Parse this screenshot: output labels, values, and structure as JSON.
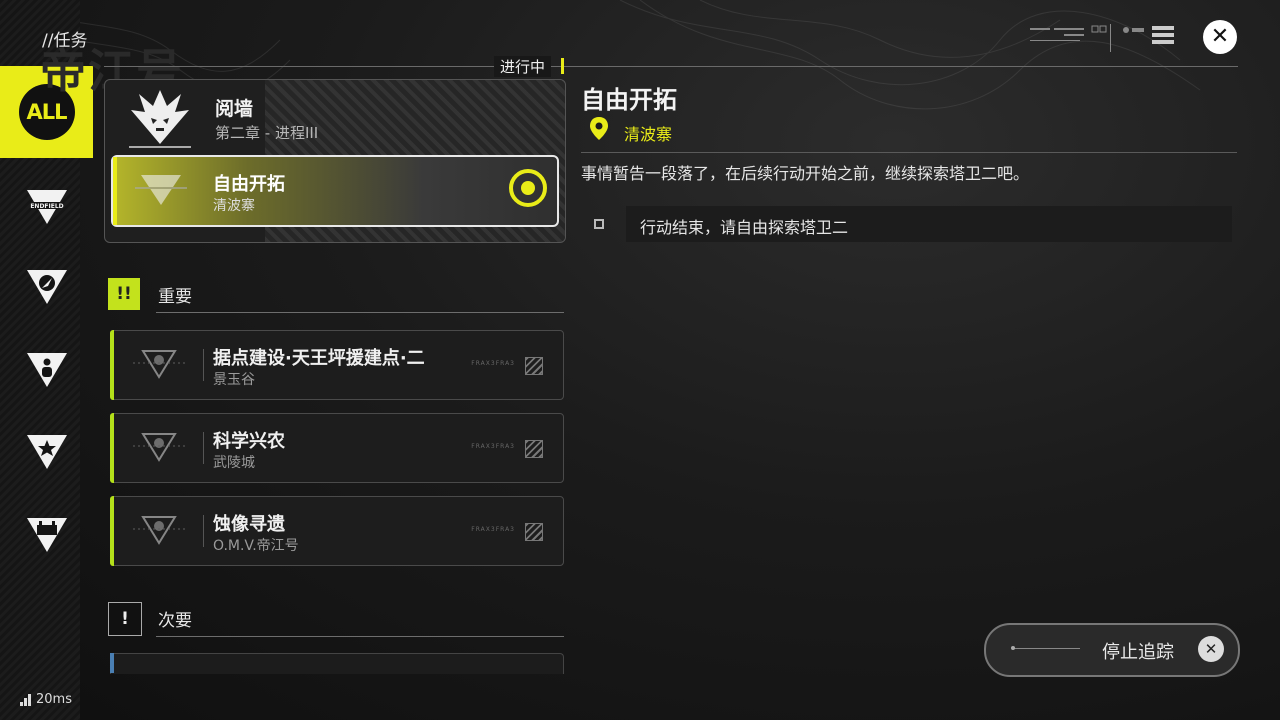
{
  "header": {
    "title": "//任务",
    "bg_title": "帝江号"
  },
  "categories": [
    {
      "key": "all",
      "label": "ALL",
      "active": true
    },
    {
      "key": "endfield",
      "label": "ENDFIELD"
    },
    {
      "key": "explore"
    },
    {
      "key": "character"
    },
    {
      "key": "star"
    },
    {
      "key": "factory"
    }
  ],
  "in_progress": {
    "label": "进行中",
    "chapter": {
      "title": "阅墙",
      "subtitle": "第二章 - 进程III"
    },
    "active_quest": {
      "title": "自由开拓",
      "location": "清波寨"
    }
  },
  "groups": {
    "main": {
      "badge": "!!",
      "label": "重要"
    },
    "side": {
      "badge": "!",
      "label": "次要"
    }
  },
  "main_quests": [
    {
      "title": "据点建设·天王坪援建点·二",
      "location": "景玉谷",
      "tag": "FRAX3FRA3"
    },
    {
      "title": "科学兴农",
      "location": "武陵城",
      "tag": "FRAX3FRA3"
    },
    {
      "title": "蚀像寻遗",
      "location": "O.M.V.帝江号",
      "tag": "FRAX3FRA3"
    }
  ],
  "detail": {
    "title": "自由开拓",
    "location": "清波寨",
    "description": "事情暂告一段落了，在后续行动开始之前，继续探索塔卫二吧。",
    "objective": "行动结束，请自由探索塔卫二"
  },
  "stop_tracking": {
    "label": "停止追踪"
  },
  "status": {
    "ping": "20ms"
  },
  "colors": {
    "accent": "#e9ec18",
    "main_stripe": "#b4e01a",
    "side_stripe": "#4a7fb3"
  }
}
